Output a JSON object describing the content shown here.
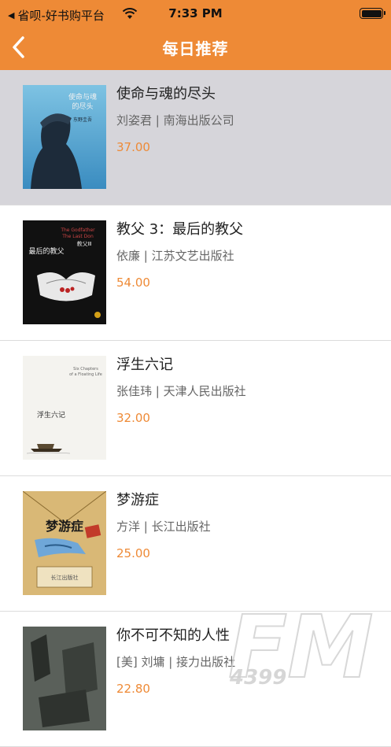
{
  "status": {
    "carrier_label": "省呗-好书购平台",
    "time": "7:33 PM"
  },
  "nav": {
    "title": "每日推荐"
  },
  "books": [
    {
      "title": "使命与魂的尽头",
      "meta": "刘姿君 | 南海出版公司",
      "price": "37.00",
      "cover_title": "使命与魂的尽头"
    },
    {
      "title": "教父 3：最后的教父",
      "meta": "依廉 | 江苏文艺出版社",
      "price": "54.00",
      "cover_title": "最后的教父"
    },
    {
      "title": "浮生六记",
      "meta": "张佳玮 | 天津人民出版社",
      "price": "32.00",
      "cover_title": "浮生六记"
    },
    {
      "title": "梦游症",
      "meta": "方洋 | 长江出版社",
      "price": "25.00",
      "cover_title": "梦游症"
    },
    {
      "title": "你不可不知的人性",
      "meta": "[美] 刘墉 | 接力出版社",
      "price": "22.80",
      "cover_title": ""
    }
  ],
  "watermark": {
    "text": "FM",
    "sub": "4399"
  },
  "colors": {
    "accent": "#ee8a36",
    "selected_row": "#d6d5da"
  }
}
